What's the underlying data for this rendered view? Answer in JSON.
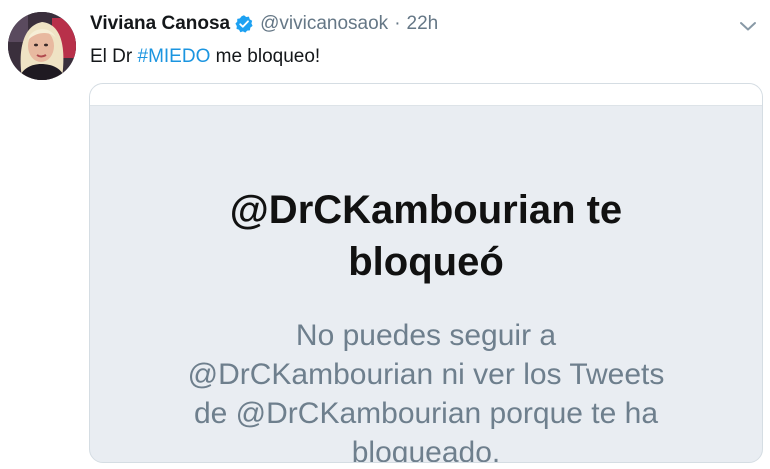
{
  "tweet": {
    "display_name": "Viviana Canosa",
    "handle": "@vivicanosaok",
    "separator": "·",
    "timestamp": "22h",
    "text_before": "El Dr ",
    "hashtag": "#MIEDO",
    "text_after": " me bloqueo!",
    "icons": {
      "verified": "verified-badge-icon",
      "more": "chevron-down-icon"
    },
    "colors": {
      "link": "#1b95e0",
      "verified": "#1da1f2",
      "muted": "#657786"
    }
  },
  "card": {
    "title_lines": [
      "@DrCKambourian te",
      "bloqueó"
    ],
    "body_lines": [
      "No puedes seguir a",
      "@DrCKambourian ni ver los Tweets",
      "de @DrCKambourian porque te ha",
      "bloqueado."
    ],
    "colors": {
      "background": "#e9edf2",
      "body_text": "#6e7f8d"
    }
  }
}
